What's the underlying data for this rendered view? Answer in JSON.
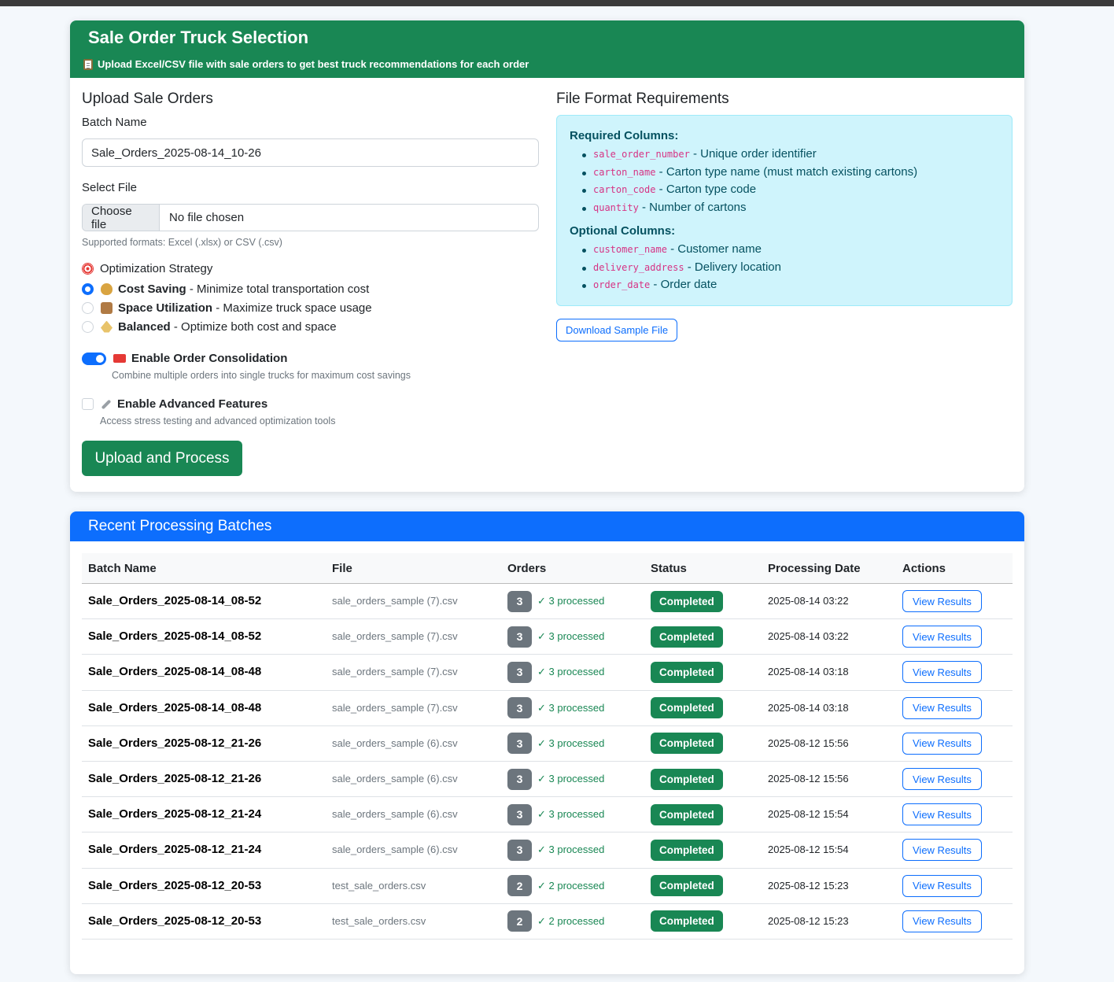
{
  "upload_card": {
    "title": "Sale Order Truck Selection",
    "subtitle": "Upload Excel/CSV file with sale orders to get best truck recommendations for each order",
    "section_title": "Upload Sale Orders",
    "batch_name_label": "Batch Name",
    "batch_name_value": "Sale_Orders_2025-08-14_10-26",
    "select_file_label": "Select File",
    "choose_file_button": "Choose file",
    "no_file_text": "No file chosen",
    "formats_help": "Supported formats: Excel (.xlsx) or CSV (.csv)",
    "strategy_label": "Optimization Strategy",
    "strategies": [
      {
        "name": "Cost Saving",
        "desc": " - Minimize total transportation cost",
        "selected": true
      },
      {
        "name": "Space Utilization",
        "desc": " - Maximize truck space usage",
        "selected": false
      },
      {
        "name": "Balanced",
        "desc": " - Optimize both cost and space",
        "selected": false
      }
    ],
    "consolidation_label": "Enable Order Consolidation",
    "consolidation_help": "Combine multiple orders into single trucks for maximum cost savings",
    "advanced_label": "Enable Advanced Features",
    "advanced_help": "Access stress testing and advanced optimization tools",
    "upload_button": "Upload and Process"
  },
  "requirements": {
    "title": "File Format Requirements",
    "required_heading": "Required Columns:",
    "required": [
      {
        "code": "sale_order_number",
        "desc": " - Unique order identifier"
      },
      {
        "code": "carton_name",
        "desc": " - Carton type name (must match existing cartons)"
      },
      {
        "code": "carton_code",
        "desc": " - Carton type code"
      },
      {
        "code": "quantity",
        "desc": " - Number of cartons"
      }
    ],
    "optional_heading": "Optional Columns:",
    "optional": [
      {
        "code": "customer_name",
        "desc": " - Customer name"
      },
      {
        "code": "delivery_address",
        "desc": " - Delivery location"
      },
      {
        "code": "order_date",
        "desc": " - Order date"
      }
    ],
    "download_button": "Download Sample File"
  },
  "batches": {
    "title": "Recent Processing Batches",
    "columns": [
      "Batch Name",
      "File",
      "Orders",
      "Status",
      "Processing Date",
      "Actions"
    ],
    "rows": [
      {
        "name": "Sale_Orders_2025-08-14_08-52",
        "file": "sale_orders_sample (7).csv",
        "count": "3",
        "processed": "✓ 3 processed",
        "status": "Completed",
        "date": "2025-08-14 03:22",
        "action": "View Results"
      },
      {
        "name": "Sale_Orders_2025-08-14_08-52",
        "file": "sale_orders_sample (7).csv",
        "count": "3",
        "processed": "✓ 3 processed",
        "status": "Completed",
        "date": "2025-08-14 03:22",
        "action": "View Results"
      },
      {
        "name": "Sale_Orders_2025-08-14_08-48",
        "file": "sale_orders_sample (7).csv",
        "count": "3",
        "processed": "✓ 3 processed",
        "status": "Completed",
        "date": "2025-08-14 03:18",
        "action": "View Results"
      },
      {
        "name": "Sale_Orders_2025-08-14_08-48",
        "file": "sale_orders_sample (7).csv",
        "count": "3",
        "processed": "✓ 3 processed",
        "status": "Completed",
        "date": "2025-08-14 03:18",
        "action": "View Results"
      },
      {
        "name": "Sale_Orders_2025-08-12_21-26",
        "file": "sale_orders_sample (6).csv",
        "count": "3",
        "processed": "✓ 3 processed",
        "status": "Completed",
        "date": "2025-08-12 15:56",
        "action": "View Results"
      },
      {
        "name": "Sale_Orders_2025-08-12_21-26",
        "file": "sale_orders_sample (6).csv",
        "count": "3",
        "processed": "✓ 3 processed",
        "status": "Completed",
        "date": "2025-08-12 15:56",
        "action": "View Results"
      },
      {
        "name": "Sale_Orders_2025-08-12_21-24",
        "file": "sale_orders_sample (6).csv",
        "count": "3",
        "processed": "✓ 3 processed",
        "status": "Completed",
        "date": "2025-08-12 15:54",
        "action": "View Results"
      },
      {
        "name": "Sale_Orders_2025-08-12_21-24",
        "file": "sale_orders_sample (6).csv",
        "count": "3",
        "processed": "✓ 3 processed",
        "status": "Completed",
        "date": "2025-08-12 15:54",
        "action": "View Results"
      },
      {
        "name": "Sale_Orders_2025-08-12_20-53",
        "file": "test_sale_orders.csv",
        "count": "2",
        "processed": "✓ 2 processed",
        "status": "Completed",
        "date": "2025-08-12 15:23",
        "action": "View Results"
      },
      {
        "name": "Sale_Orders_2025-08-12_20-53",
        "file": "test_sale_orders.csv",
        "count": "2",
        "processed": "✓ 2 processed",
        "status": "Completed",
        "date": "2025-08-12 15:23",
        "action": "View Results"
      }
    ]
  },
  "colors": {
    "success": "#198754",
    "primary": "#0d6efd",
    "info_bg": "#cff4fc",
    "secondary": "#6c757d"
  },
  "icons": {
    "subtitle": "clipboard-icon",
    "strategy": "target-icon",
    "strategies": [
      "money-bag-icon",
      "package-icon",
      "scale-icon"
    ],
    "consolidation": "truck-icon",
    "advanced": "wrench-icon"
  }
}
